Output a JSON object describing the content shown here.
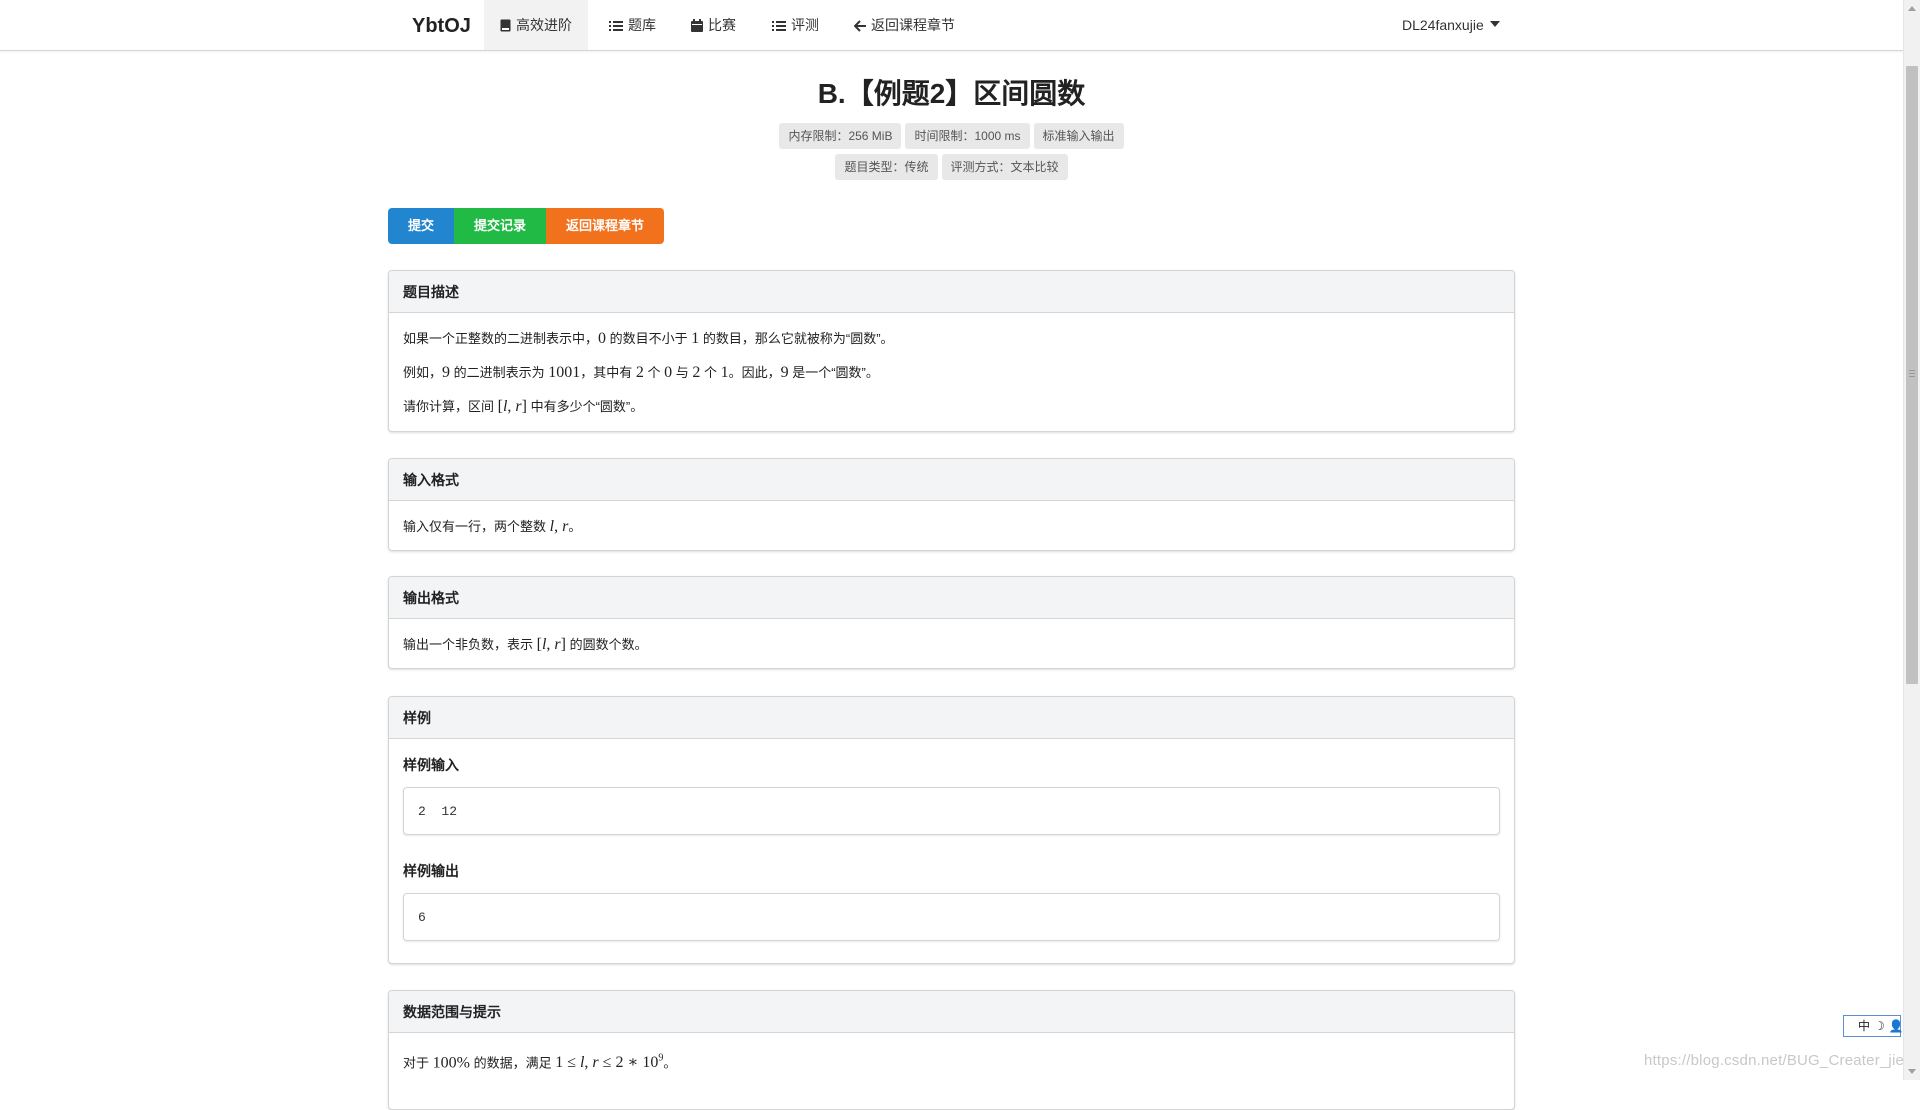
{
  "nav": {
    "brand": "YbtOJ",
    "items": [
      {
        "label": "高效进阶",
        "icon": "book-icon"
      },
      {
        "label": "题库",
        "icon": "list-icon"
      },
      {
        "label": "比赛",
        "icon": "calendar-icon"
      },
      {
        "label": "评测",
        "icon": "tasks-icon"
      },
      {
        "label": "返回课程章节",
        "icon": "arrow-left-icon"
      }
    ],
    "user": "DL24fanxujie"
  },
  "problem": {
    "title": "B.【例题2】区间圆数",
    "labels_row1": [
      "内存限制：256 MiB",
      "时间限制：1000 ms",
      "标准输入输出"
    ],
    "labels_row2": [
      "题目类型：传统",
      "评测方式：文本比较"
    ]
  },
  "buttons": {
    "submit": "提交",
    "records": "提交记录",
    "back": "返回课程章节"
  },
  "description": {
    "header": "题目描述",
    "line1": {
      "a": "如果一个正整数的二进制表示中，",
      "m1": "0",
      "b": " 的数目不小于 ",
      "m2": "1",
      "c": " 的数目，那么它就被称为“圆数”。"
    },
    "line2": {
      "a": "例如，",
      "m1": "9",
      "b": " 的二进制表示为 ",
      "m2": "1001",
      "c": "，其中有 ",
      "m3": "2",
      "d": " 个 ",
      "m4": "0",
      "e": " 与 ",
      "m5": "2",
      "f": " 个 ",
      "m6": "1",
      "g": "。因此，",
      "m7": "9",
      "h": " 是一个“圆数”。"
    },
    "line3": {
      "a": "请你计算，区间 ",
      "m1_open": "[",
      "m1_l": "l",
      "m1_sep": ", ",
      "m1_r": "r",
      "m1_close": "]",
      "b": " 中有多少个“圆数”。"
    }
  },
  "input_format": {
    "header": "输入格式",
    "a": "输入仅有一行，两个整数 ",
    "m_l": "l",
    "m_sep": ", ",
    "m_r": "r",
    "b": "。"
  },
  "output_format": {
    "header": "输出格式",
    "a": "输出一个非负数，表示 ",
    "m_open": "[",
    "m_l": "l",
    "m_sep": ", ",
    "m_r": "r",
    "m_close": "]",
    "b": " 的圆数个数。"
  },
  "sample": {
    "header": "样例",
    "input_label": "样例输入",
    "input_value": "2  12",
    "output_label": "样例输出",
    "output_value": "6"
  },
  "hint": {
    "header": "数据范围与提示",
    "a": "对于 ",
    "pct": "100%",
    "b": " 的数据，满足 ",
    "m1": "1 ≤ ",
    "m_l": "l",
    "m_sep": ", ",
    "m_r": "r",
    "m2": " ≤ 2 ∗ 10",
    "m_exp": "9",
    "c": "。"
  },
  "ime": {
    "lang": "中",
    "moon": "☽",
    "person": "👤"
  },
  "watermark": "https://blog.csdn.net/BUG_Creater_jie",
  "colors": {
    "blue": "#2185d0",
    "green": "#21ba45",
    "orange": "#f2711c"
  }
}
